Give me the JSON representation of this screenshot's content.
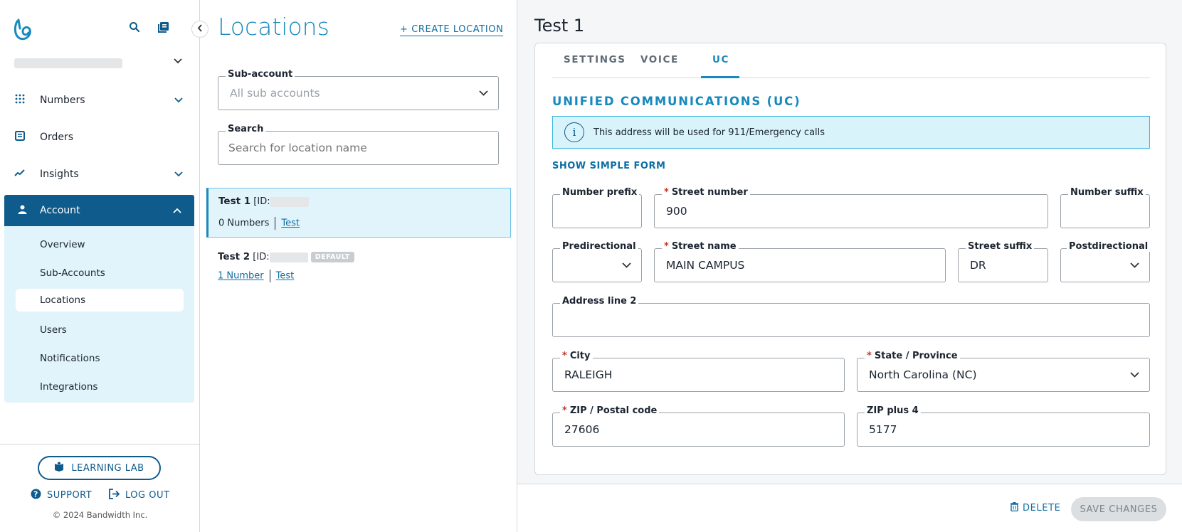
{
  "sidebar": {
    "nav": [
      {
        "label": "Numbers"
      },
      {
        "label": "Orders"
      },
      {
        "label": "Insights"
      },
      {
        "label": "Account"
      }
    ],
    "account_subnav": [
      {
        "label": "Overview"
      },
      {
        "label": "Sub-Accounts"
      },
      {
        "label": "Locations"
      },
      {
        "label": "Users"
      },
      {
        "label": "Notifications"
      },
      {
        "label": "Integrations"
      }
    ],
    "learning_lab": "LEARNING LAB",
    "support": "SUPPORT",
    "logout": "LOG OUT",
    "copyright": "© 2024 Bandwidth Inc."
  },
  "locations": {
    "title": "Locations",
    "create_label": "+ CREATE LOCATION",
    "subaccount": {
      "label": "Sub-account",
      "placeholder": "All sub accounts"
    },
    "search": {
      "label": "Search",
      "placeholder": "Search for location name"
    },
    "items": [
      {
        "name": "Test 1",
        "id_prefix": "[ID:",
        "numbers": "0 Numbers",
        "link": "Test"
      },
      {
        "name": "Test 2",
        "id_prefix": "[ID:",
        "badge": "DEFAULT",
        "numbers": "1 Number",
        "link": "Test"
      }
    ]
  },
  "detail": {
    "title": "Test 1",
    "tabs": [
      {
        "label": "SETTINGS"
      },
      {
        "label": "VOICE"
      },
      {
        "label": "UC"
      }
    ],
    "active_tab": "UC",
    "section_title": "UNIFIED COMMUNICATIONS (UC)",
    "info_icon": "info-icon",
    "info_text": "This address will be used for 911/Emergency calls",
    "simple_form_link": "SHOW SIMPLE FORM",
    "fields": {
      "number_prefix": {
        "label": "Number prefix",
        "value": ""
      },
      "street_number": {
        "label": "Street number",
        "value": "900"
      },
      "number_suffix": {
        "label": "Number suffix",
        "value": ""
      },
      "predirectional": {
        "label": "Predirectional",
        "value": ""
      },
      "street_name": {
        "label": "Street name",
        "value": "MAIN CAMPUS"
      },
      "street_suffix": {
        "label": "Street suffix",
        "value": "DR"
      },
      "postdirectional": {
        "label": "Postdirectional",
        "value": ""
      },
      "address_line2": {
        "label": "Address line 2",
        "value": ""
      },
      "city": {
        "label": "City",
        "value": "RALEIGH"
      },
      "state": {
        "label": "State / Province",
        "value": "North Carolina (NC)"
      },
      "zip": {
        "label": "ZIP / Postal code",
        "value": "27606"
      },
      "zip4": {
        "label": "ZIP plus 4",
        "value": "5177"
      }
    },
    "delete_label": "DELETE",
    "save_label": "SAVE CHANGES"
  },
  "colors": {
    "brand": "#0e5b8c",
    "accent": "#1789bd",
    "highlight": "#e2f4fb"
  }
}
